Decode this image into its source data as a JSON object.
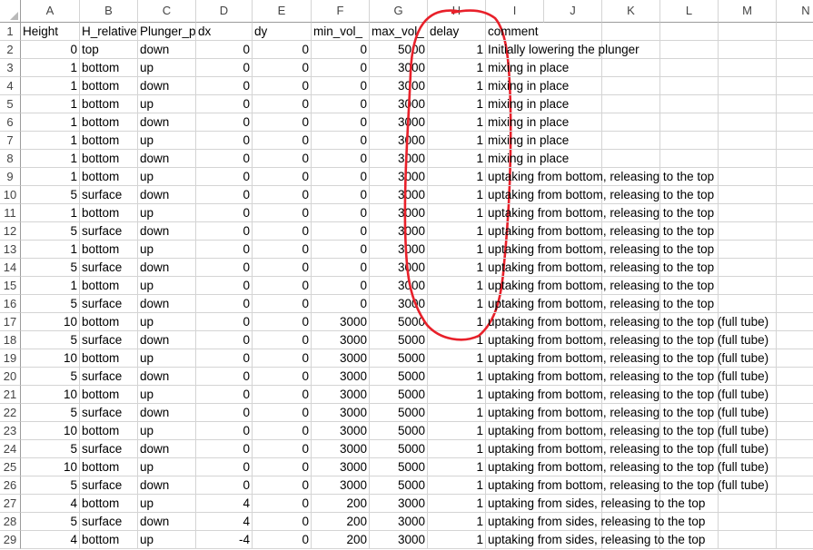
{
  "columns": [
    "A",
    "B",
    "C",
    "D",
    "E",
    "F",
    "G",
    "H",
    "I",
    "J",
    "K",
    "L",
    "M",
    "N"
  ],
  "headers": [
    "Height",
    "H_relative",
    "Plunger_p",
    "dx",
    "dy",
    "min_vol_",
    "max_vol_",
    "delay",
    "comment"
  ],
  "rows": [
    [
      "0",
      "top",
      "down",
      "0",
      "0",
      "0",
      "5000",
      "1",
      "Initially lowering the plunger"
    ],
    [
      "1",
      "bottom",
      "up",
      "0",
      "0",
      "0",
      "3000",
      "1",
      "mixing in place"
    ],
    [
      "1",
      "bottom",
      "down",
      "0",
      "0",
      "0",
      "3000",
      "1",
      "mixing in place"
    ],
    [
      "1",
      "bottom",
      "up",
      "0",
      "0",
      "0",
      "3000",
      "1",
      "mixing in place"
    ],
    [
      "1",
      "bottom",
      "down",
      "0",
      "0",
      "0",
      "3000",
      "1",
      "mixing in place"
    ],
    [
      "1",
      "bottom",
      "up",
      "0",
      "0",
      "0",
      "3000",
      "1",
      "mixing in place"
    ],
    [
      "1",
      "bottom",
      "down",
      "0",
      "0",
      "0",
      "3000",
      "1",
      "mixing in place"
    ],
    [
      "1",
      "bottom",
      "up",
      "0",
      "0",
      "0",
      "3000",
      "1",
      "uptaking from bottom, releasing to the top"
    ],
    [
      "5",
      "surface",
      "down",
      "0",
      "0",
      "0",
      "3000",
      "1",
      "uptaking from bottom, releasing to the top"
    ],
    [
      "1",
      "bottom",
      "up",
      "0",
      "0",
      "0",
      "3000",
      "1",
      "uptaking from bottom, releasing to the top"
    ],
    [
      "5",
      "surface",
      "down",
      "0",
      "0",
      "0",
      "3000",
      "1",
      "uptaking from bottom, releasing to the top"
    ],
    [
      "1",
      "bottom",
      "up",
      "0",
      "0",
      "0",
      "3000",
      "1",
      "uptaking from bottom, releasing to the top"
    ],
    [
      "5",
      "surface",
      "down",
      "0",
      "0",
      "0",
      "3000",
      "1",
      "uptaking from bottom, releasing to the top"
    ],
    [
      "1",
      "bottom",
      "up",
      "0",
      "0",
      "0",
      "3000",
      "1",
      "uptaking from bottom, releasing to the top"
    ],
    [
      "5",
      "surface",
      "down",
      "0",
      "0",
      "0",
      "3000",
      "1",
      "uptaking from bottom, releasing to the top"
    ],
    [
      "10",
      "bottom",
      "up",
      "0",
      "0",
      "3000",
      "5000",
      "1",
      "uptaking from bottom, releasing to the top (full tube)"
    ],
    [
      "5",
      "surface",
      "down",
      "0",
      "0",
      "3000",
      "5000",
      "1",
      "uptaking from bottom, releasing to the top (full tube)"
    ],
    [
      "10",
      "bottom",
      "up",
      "0",
      "0",
      "3000",
      "5000",
      "1",
      "uptaking from bottom, releasing to the top (full tube)"
    ],
    [
      "5",
      "surface",
      "down",
      "0",
      "0",
      "3000",
      "5000",
      "1",
      "uptaking from bottom, releasing to the top (full tube)"
    ],
    [
      "10",
      "bottom",
      "up",
      "0",
      "0",
      "3000",
      "5000",
      "1",
      "uptaking from bottom, releasing to the top (full tube)"
    ],
    [
      "5",
      "surface",
      "down",
      "0",
      "0",
      "3000",
      "5000",
      "1",
      "uptaking from bottom, releasing to the top (full tube)"
    ],
    [
      "10",
      "bottom",
      "up",
      "0",
      "0",
      "3000",
      "5000",
      "1",
      "uptaking from bottom, releasing to the top (full tube)"
    ],
    [
      "5",
      "surface",
      "down",
      "0",
      "0",
      "3000",
      "5000",
      "1",
      "uptaking from bottom, releasing to the top (full tube)"
    ],
    [
      "10",
      "bottom",
      "up",
      "0",
      "0",
      "3000",
      "5000",
      "1",
      "uptaking from bottom, releasing to the top (full tube)"
    ],
    [
      "5",
      "surface",
      "down",
      "0",
      "0",
      "3000",
      "5000",
      "1",
      "uptaking from bottom, releasing to the top (full tube)"
    ],
    [
      "4",
      "bottom",
      "up",
      "4",
      "0",
      "200",
      "3000",
      "1",
      "uptaking from sides, releasing to the top"
    ],
    [
      "5",
      "surface",
      "down",
      "4",
      "0",
      "200",
      "3000",
      "1",
      "uptaking from sides, releasing to the top"
    ],
    [
      "4",
      "bottom",
      "up",
      "-4",
      "0",
      "200",
      "3000",
      "1",
      "uptaking from sides, releasing to the top"
    ]
  ],
  "annotation": {
    "shape": "hand-drawn-circle",
    "color": "#e8202a",
    "around_column": "H"
  }
}
